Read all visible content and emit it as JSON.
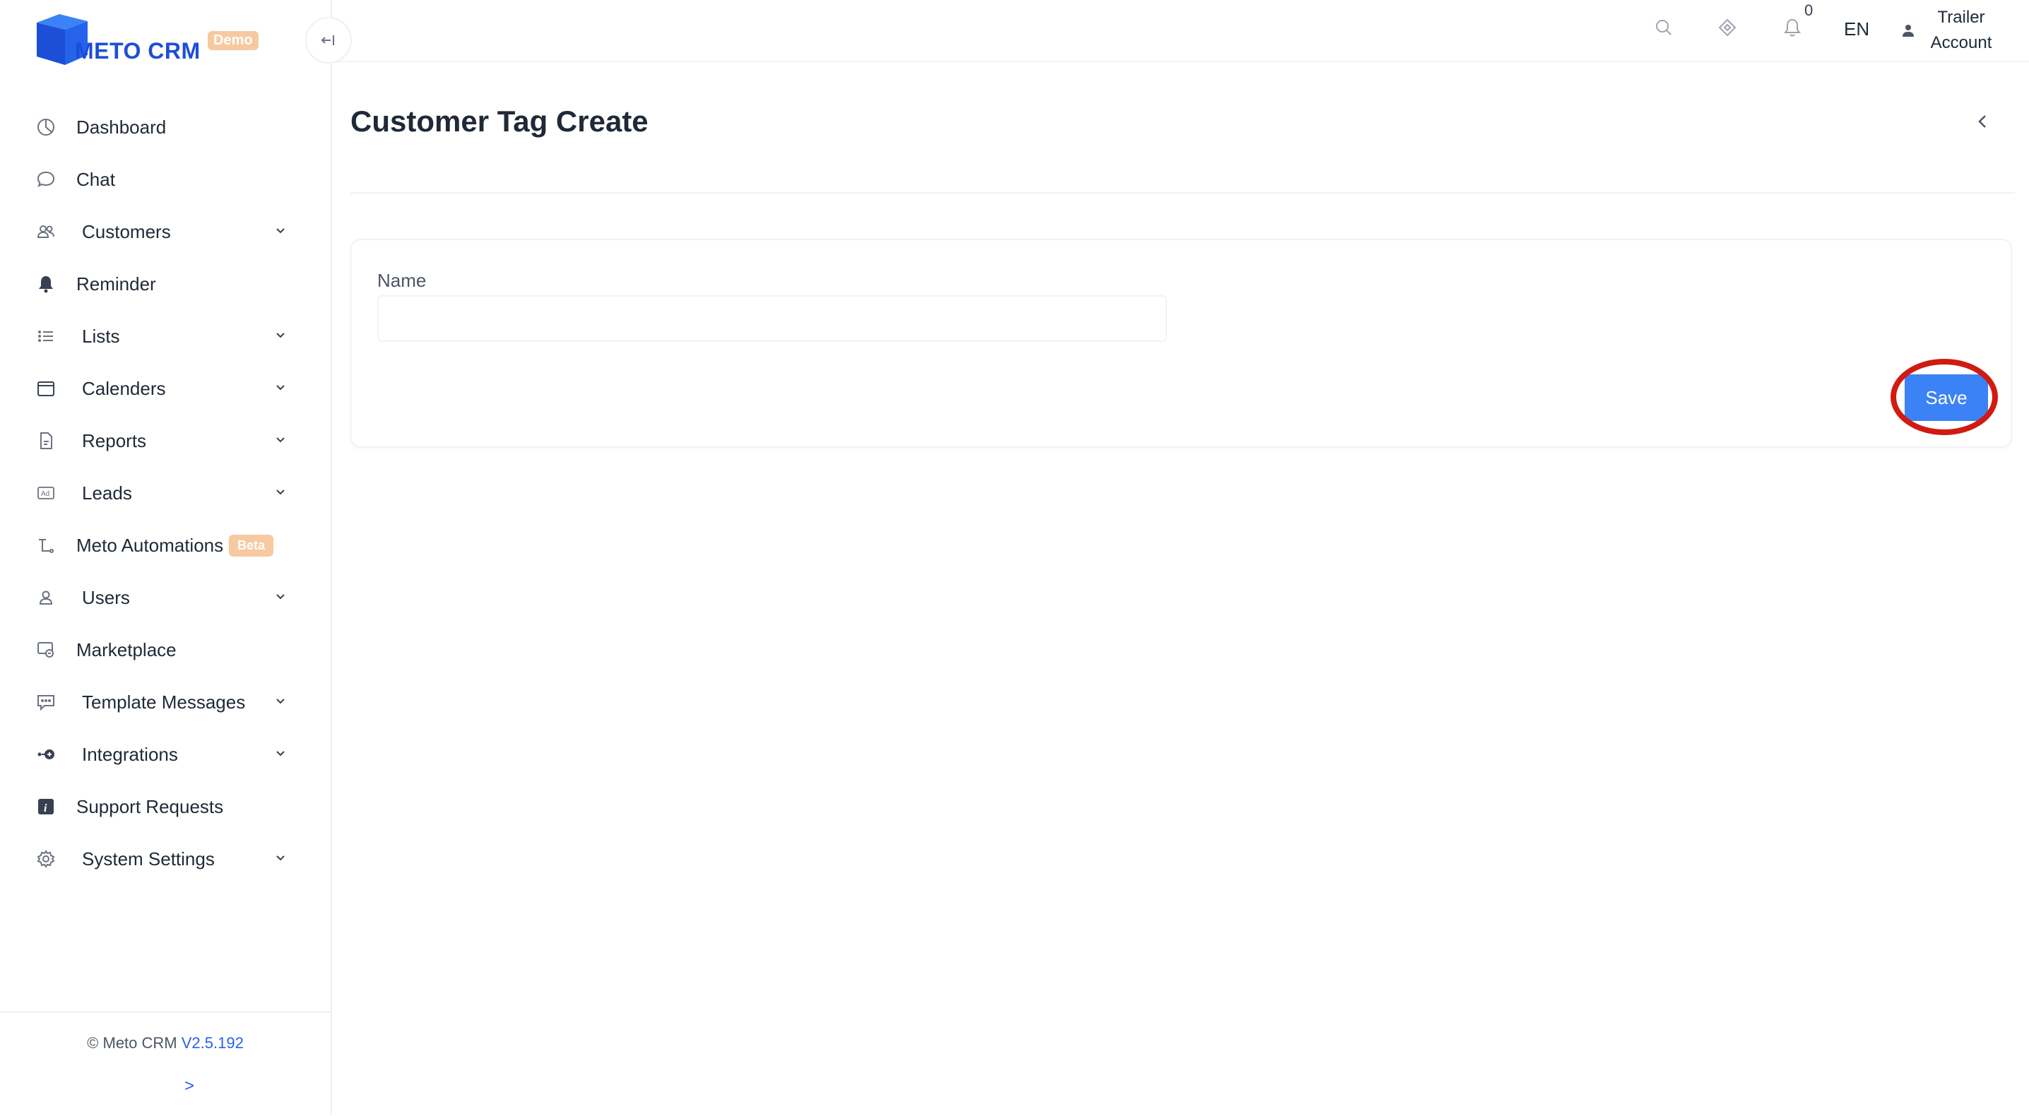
{
  "brand": {
    "name": "METO CRM",
    "badge": "Demo"
  },
  "sidebar": {
    "items": [
      {
        "label": "Dashboard",
        "icon": "dashboard-icon",
        "expandable": false
      },
      {
        "label": "Chat",
        "icon": "chat-icon",
        "expandable": false
      },
      {
        "label": "Customers",
        "icon": "customers-icon",
        "expandable": true
      },
      {
        "label": "Reminder",
        "icon": "bell-icon",
        "expandable": false
      },
      {
        "label": "Lists",
        "icon": "list-icon",
        "expandable": true
      },
      {
        "label": "Calenders",
        "icon": "calendar-icon",
        "expandable": true
      },
      {
        "label": "Reports",
        "icon": "report-icon",
        "expandable": true
      },
      {
        "label": "Leads",
        "icon": "ad-icon",
        "expandable": true
      },
      {
        "label": "Meto Automations",
        "icon": "automation-icon",
        "expandable": false,
        "badge": "Beta"
      },
      {
        "label": "Users",
        "icon": "user-icon",
        "expandable": true
      },
      {
        "label": "Marketplace",
        "icon": "marketplace-icon",
        "expandable": false
      },
      {
        "label": "Template Messages",
        "icon": "message-template-icon",
        "expandable": true
      },
      {
        "label": "Integrations",
        "icon": "integration-icon",
        "expandable": true
      },
      {
        "label": "Support Requests",
        "icon": "info-icon",
        "expandable": false
      },
      {
        "label": "System Settings",
        "icon": "settings-icon",
        "expandable": true
      }
    ],
    "footer": {
      "copyright": "© Meto CRM",
      "version": "V2.5.192",
      "expand": ">"
    }
  },
  "topbar": {
    "notification_count": "0",
    "language": "EN",
    "account_line1": "Trailer",
    "account_line2": "Account"
  },
  "main": {
    "title": "Customer Tag Create",
    "form": {
      "name_label": "Name",
      "name_value": "",
      "name_placeholder": "",
      "save_label": "Save"
    }
  },
  "colors": {
    "accent": "#3b82f6",
    "brand": "#1d4ed8",
    "badge": "#f6c9a1",
    "highlight": "#d11a12"
  }
}
